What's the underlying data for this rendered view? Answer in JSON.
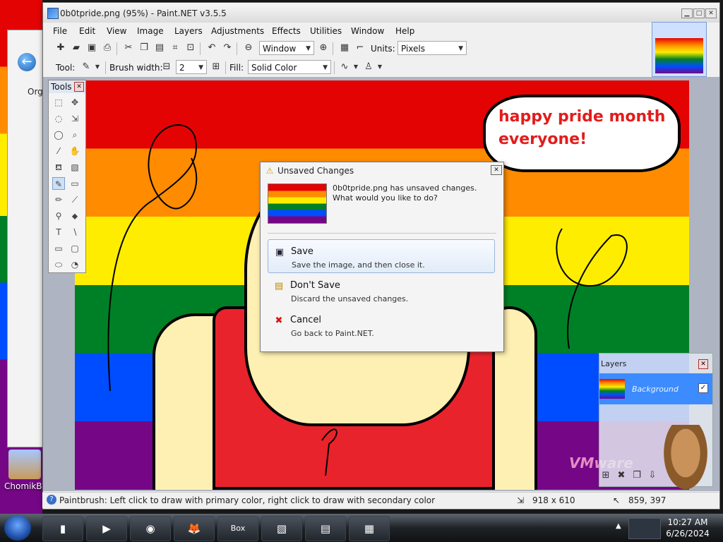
{
  "desktop": {
    "left_window_label": "Org",
    "icon_label": "ChomikB"
  },
  "window": {
    "title": "0b0tpride.png (95%) - Paint.NET v3.5.5",
    "controls": {
      "minimize": "▁",
      "maximize": "□",
      "close": "✕"
    }
  },
  "menu": [
    "File",
    "Edit",
    "View",
    "Image",
    "Layers",
    "Adjustments",
    "Effects",
    "Utilities",
    "Window",
    "Help"
  ],
  "toolbar": {
    "zoom_value": "Window",
    "units_label": "Units:",
    "units_value": "Pixels",
    "tool_label": "Tool:",
    "brush_width_label": "Brush width:",
    "brush_width_value": "2",
    "fill_label": "Fill:",
    "fill_value": "Solid Color"
  },
  "canvas": {
    "bubble_text_line1": "happy pride month",
    "bubble_text_line2": "everyone!",
    "watermark": "VMware"
  },
  "tools_window": {
    "title": "Tools",
    "close": "✕"
  },
  "layers": {
    "title": "Layers",
    "layer_name": "Background",
    "checked": "✓",
    "close": "✕"
  },
  "dialog": {
    "title": "Unsaved Changes",
    "message": "0b0tpride.png has unsaved changes. What would you like to do?",
    "close": "✕",
    "options": [
      {
        "title": "Save",
        "desc": "Save the image, and then close it."
      },
      {
        "title": "Don't Save",
        "desc": "Discard the unsaved changes."
      },
      {
        "title": "Cancel",
        "desc": "Go back to Paint.NET."
      }
    ]
  },
  "status": {
    "hint": "Paintbrush: Left click to draw with primary color, right click to draw with secondary color",
    "image_size": "918 x 610",
    "cursor_pos": "859, 397"
  },
  "taskbar": {
    "time": "10:27 AM",
    "date": "6/26/2024",
    "boxed_label": "Box"
  },
  "colors": {
    "accent_blue": "#3d8cff",
    "bubble_text": "#e31c1c",
    "shirt_red": "#e9232b",
    "skin": "#fdf0b2"
  }
}
